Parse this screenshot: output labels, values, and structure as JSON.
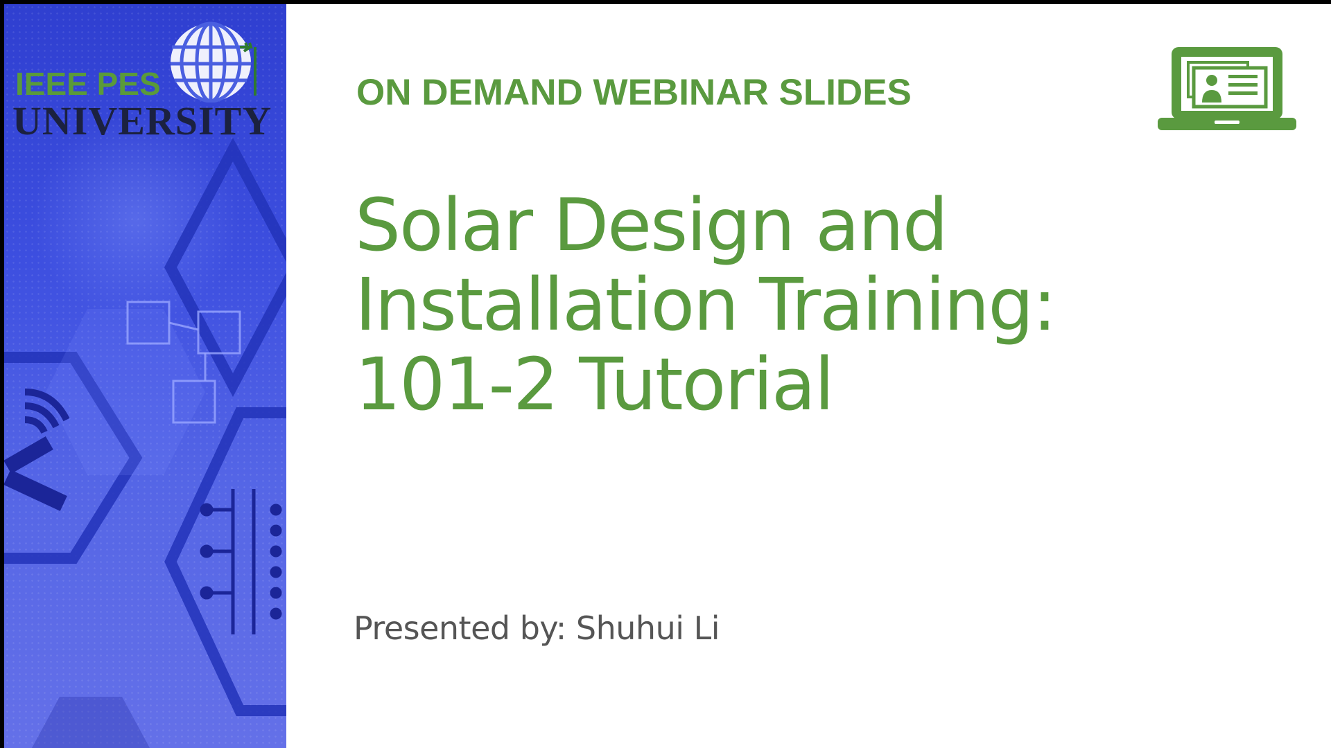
{
  "banner": {
    "logo": {
      "line1": "IEEE PES",
      "line2": "UNIVERSITY",
      "globe_icon": "globe-icon"
    }
  },
  "kicker": "ON DEMAND WEBINAR SLIDES",
  "title": {
    "lines": [
      "Solar Design and",
      "Installation Training:",
      "101-2 Tutorial"
    ]
  },
  "presenter": "Presented by: Shuhui Li",
  "icons": {
    "webinar": "laptop-presentation-icon"
  },
  "colors": {
    "accent_green": "#5a9a3f",
    "banner_blue": "#3d4fe0",
    "logo_dark": "#1b2140",
    "presenter_gray": "#555555"
  }
}
